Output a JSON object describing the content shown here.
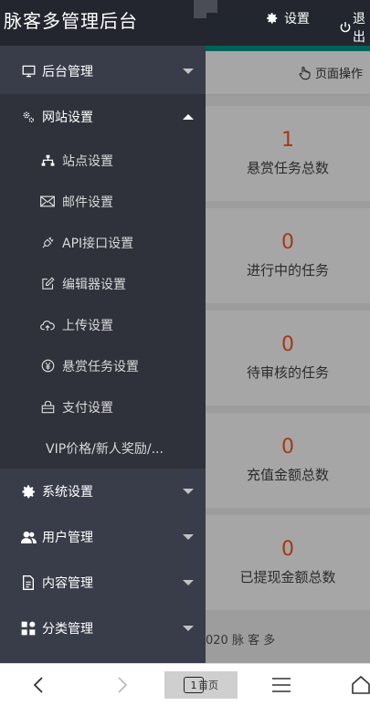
{
  "header": {
    "title": "脉客多管理后台",
    "settings_label": "设置",
    "logout_label": "退出"
  },
  "content": {
    "toolbar_label": "页面操作",
    "stats": [
      {
        "value": "1",
        "label": "悬赏任务总数"
      },
      {
        "value": "0",
        "label": "进行中的任务"
      },
      {
        "value": "0",
        "label": "待审核的任务"
      },
      {
        "value": "0",
        "label": "充值金额总数"
      },
      {
        "value": "0",
        "label": "已提现金额总数"
      }
    ],
    "footer": "020 脉 客 多"
  },
  "sidebar": {
    "items": [
      {
        "label": "后台管理",
        "icon": "monitor-icon"
      },
      {
        "label": "网站设置",
        "icon": "gears-icon"
      },
      {
        "label": "系统设置",
        "icon": "gear-icon"
      },
      {
        "label": "用户管理",
        "icon": "users-icon"
      },
      {
        "label": "内容管理",
        "icon": "document-icon"
      },
      {
        "label": "分类管理",
        "icon": "apps-icon"
      }
    ],
    "subitems": [
      {
        "label": "站点设置",
        "icon": "sitemap-icon"
      },
      {
        "label": "邮件设置",
        "icon": "mail-icon"
      },
      {
        "label": "API接口设置",
        "icon": "plug-icon"
      },
      {
        "label": "编辑器设置",
        "icon": "edit-icon"
      },
      {
        "label": "上传设置",
        "icon": "cloud-upload-icon"
      },
      {
        "label": "悬赏任务设置",
        "icon": "yen-icon"
      },
      {
        "label": "支付设置",
        "icon": "bag-icon"
      },
      {
        "label": "VIP价格/新人奖励/..."
      }
    ]
  },
  "bottombar": {
    "tab_count": "1",
    "tab_label": "首页"
  },
  "colors": {
    "accent": "#009688",
    "stat_number": "#ff5722",
    "sidebar_bg": "#393d49",
    "header_bg": "#23262e"
  }
}
